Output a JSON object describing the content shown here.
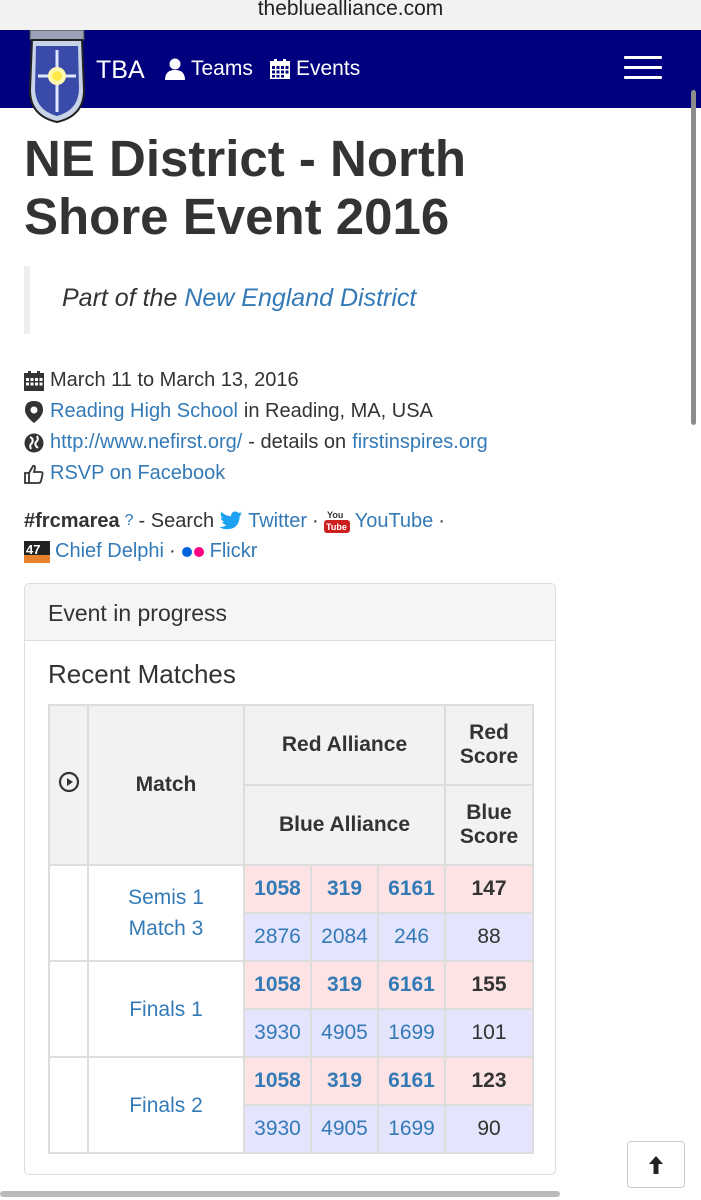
{
  "browser": {
    "url": "thebluealliance.com"
  },
  "navbar": {
    "brand": "TBA",
    "teams_label": "Teams",
    "events_label": "Events"
  },
  "event": {
    "title_line1": "NE District - North",
    "title_line2": "Shore Event 2016",
    "part_of_prefix": "Part of the",
    "district_link": "New England District",
    "dates": "March 11 to March 13, 2016",
    "venue_link": "Reading High School",
    "location_text": "in Reading, MA, USA",
    "website_link": "http://www.nefirst.org/",
    "details_text": "- details on",
    "details_link": "firstinspires.org",
    "rsvp_link": "RSVP on Facebook"
  },
  "social": {
    "hashtag": "#frcmarea",
    "question": "?",
    "search_text": "- Search",
    "twitter": "Twitter",
    "youtube": "YouTube",
    "chiefdelphi": "Chief Delphi",
    "flickr": "Flickr",
    "separator": "·"
  },
  "panel": {
    "heading": "Event in progress",
    "recent_title": "Recent Matches",
    "headers": {
      "match": "Match",
      "red_alliance": "Red Alliance",
      "red_score_1": "Red",
      "red_score_2": "Score",
      "blue_alliance": "Blue Alliance",
      "blue_score_1": "Blue",
      "blue_score_2": "Score"
    },
    "matches": [
      {
        "name_1": "Semis 1",
        "name_2": "Match 3",
        "red": [
          "1058",
          "319",
          "6161"
        ],
        "red_score": "147",
        "blue": [
          "2876",
          "2084",
          "246"
        ],
        "blue_score": "88"
      },
      {
        "name_1": "Finals 1",
        "name_2": "",
        "red": [
          "1058",
          "319",
          "6161"
        ],
        "red_score": "155",
        "blue": [
          "3930",
          "4905",
          "1699"
        ],
        "blue_score": "101"
      },
      {
        "name_1": "Finals 2",
        "name_2": "",
        "red": [
          "1058",
          "319",
          "6161"
        ],
        "red_score": "123",
        "blue": [
          "3930",
          "4905",
          "1699"
        ],
        "blue_score": "90"
      }
    ]
  },
  "colors": {
    "navbar": "#00007f",
    "link": "#337ab7",
    "red_row": "#fde3e3",
    "blue_row": "#e4e4fd"
  }
}
